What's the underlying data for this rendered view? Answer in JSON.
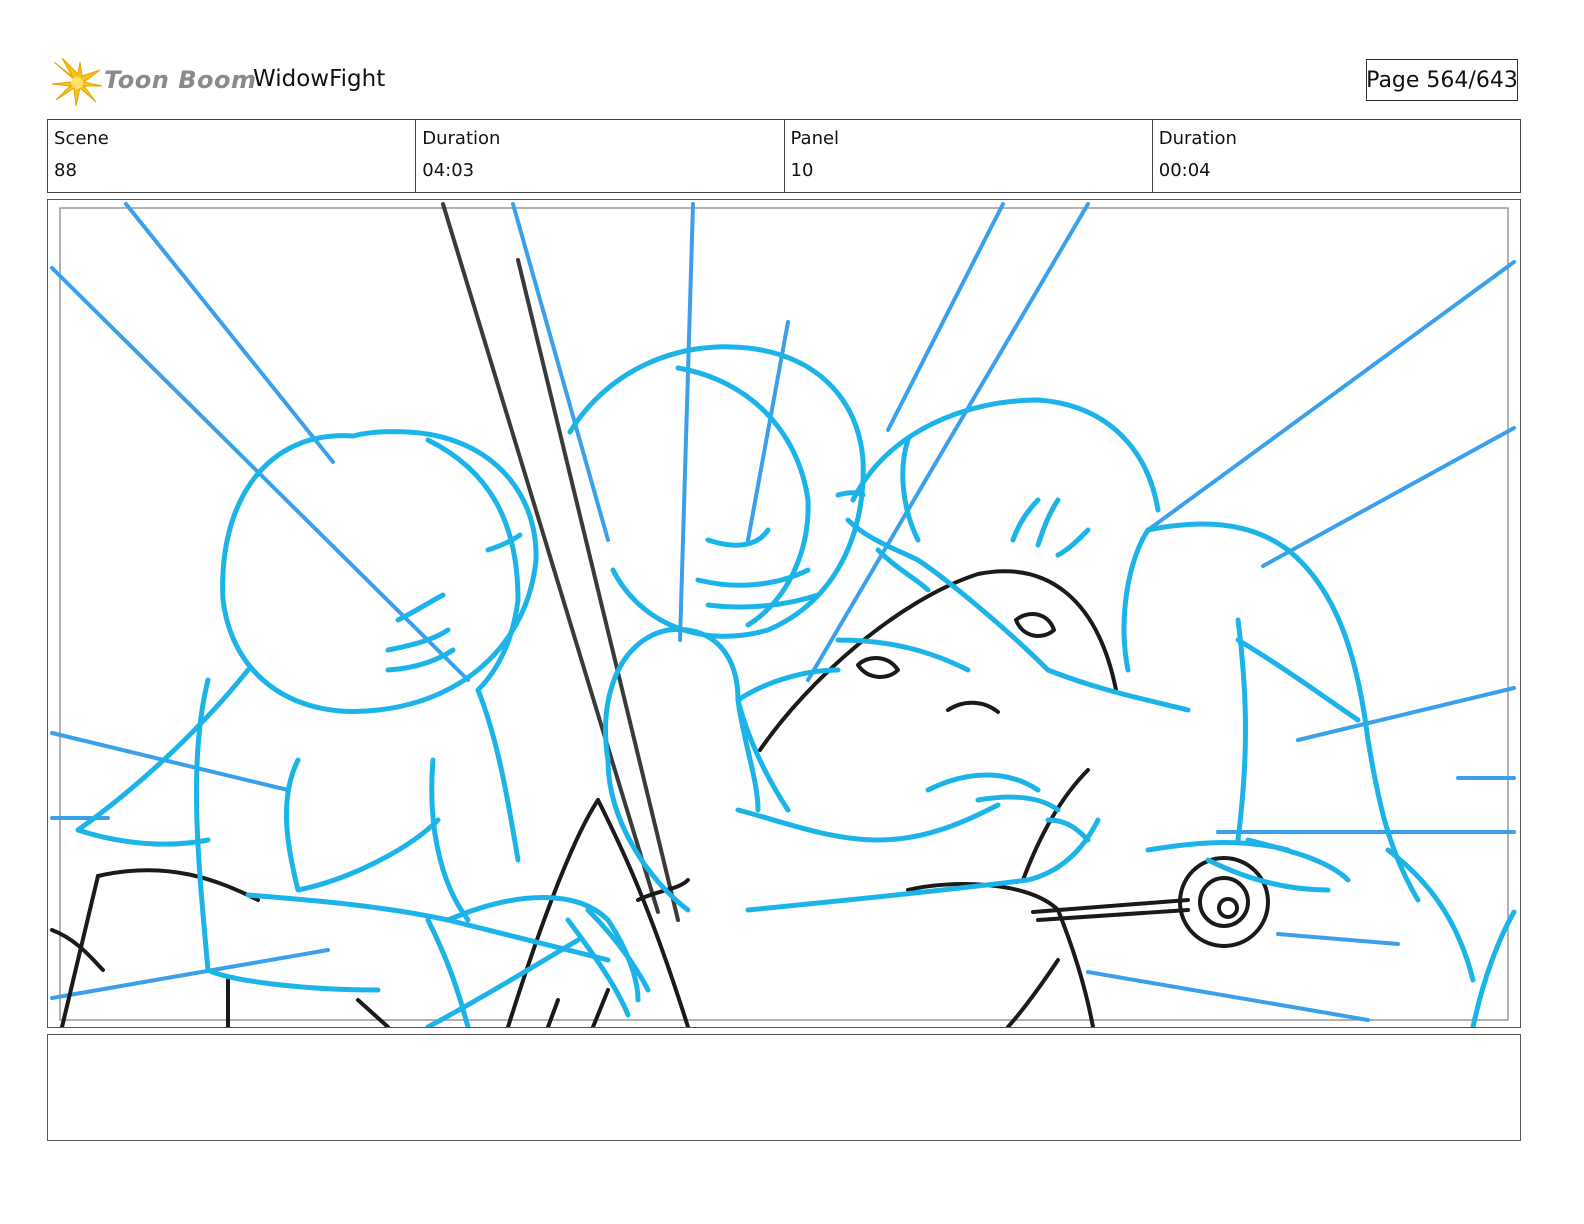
{
  "header": {
    "logo_text": "Toon Boom",
    "project_title": "WidowFight",
    "page_indicator": "Page 564/643"
  },
  "info": {
    "scene_label": "Scene",
    "scene_value": "88",
    "scene_duration_label": "Duration",
    "scene_duration_value": "04:03",
    "panel_label": "Panel",
    "panel_value": "10",
    "panel_duration_label": "Duration",
    "panel_duration_value": "00:04"
  },
  "notes": {
    "text": ""
  },
  "colors": {
    "sketch_blue": "#1cb4e8",
    "line_blue": "#3aa0ec",
    "ink": "#1a1a1a",
    "logo_yellow": "#f7c21a",
    "logo_text": "#8a8a8a"
  }
}
